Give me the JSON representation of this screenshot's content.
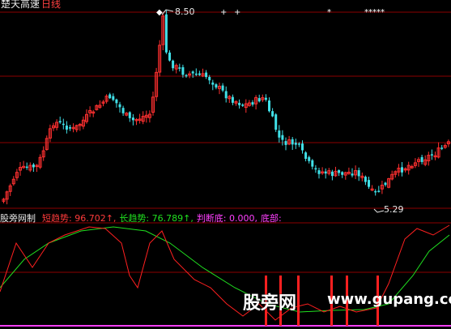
{
  "header": {
    "title": "楚天高速",
    "period": "日线"
  },
  "price_chart": {
    "high_label": "8.50",
    "low_label": "5.29",
    "star_markers": [
      "◆",
      "+",
      "+",
      "*",
      "*****"
    ]
  },
  "indicator": {
    "name": "股旁网制",
    "short_trend": "短趋势: 96.702↑,",
    "long_trend": "长趋势: 76.789↑,",
    "judge_bottom": "判断底: 0.000,",
    "bottom": "底部:"
  },
  "watermark": {
    "text": "股旁网",
    "url": "www.gupang.com"
  },
  "colors": {
    "up": "#ff3030",
    "down": "#40e0e8",
    "short_line": "#ff2020",
    "long_line": "#20e020",
    "grid": "#8b0000",
    "bottom_line": "#ff40ff"
  },
  "chart_data": {
    "type": "candlestick",
    "ylim": [
      5.0,
      8.7
    ],
    "high": 8.5,
    "low": 5.29,
    "indicator_ylim": [
      0,
      100
    ],
    "bottom_signal_count": 6
  }
}
